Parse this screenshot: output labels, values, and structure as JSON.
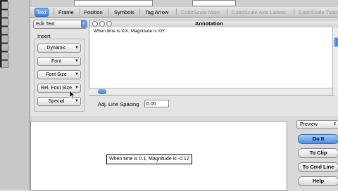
{
  "tabs": [
    {
      "label": "Text",
      "state": "active"
    },
    {
      "label": "Frame",
      "state": "normal"
    },
    {
      "label": "Position",
      "state": "normal"
    },
    {
      "label": "Symbols",
      "state": "normal"
    },
    {
      "label": "Tag Arrow",
      "state": "normal"
    },
    {
      "label": "ColorScale Main",
      "state": "disabled"
    },
    {
      "label": "ColorScale Axis Labels",
      "state": "disabled"
    },
    {
      "label": "ColorScale Ticks",
      "state": "disabled"
    }
  ],
  "edit_select": {
    "value": "Edit Text",
    "icon": "updown-arrow-icon"
  },
  "insert": {
    "label": "Insert",
    "buttons": [
      "Dynamic",
      "Font",
      "Font Size",
      "Rel. Font Size",
      "Special"
    ]
  },
  "annotation": {
    "title": "Annotation",
    "text": "When time is \\0X, Magnitude is \\0Y"
  },
  "line_spacing": {
    "label": "Adj. Line Spacing",
    "value": "0.00"
  },
  "preview": {
    "text": "When time is 0.1, Magnitude is -0.12"
  },
  "right_panel": {
    "preview_select": "Preview",
    "buttons": [
      "Do It",
      "To Clip",
      "To Cmd Line",
      "Help"
    ]
  },
  "colors": {
    "accent": "#4c8ee0",
    "tab_active": "#3f7fd6"
  }
}
